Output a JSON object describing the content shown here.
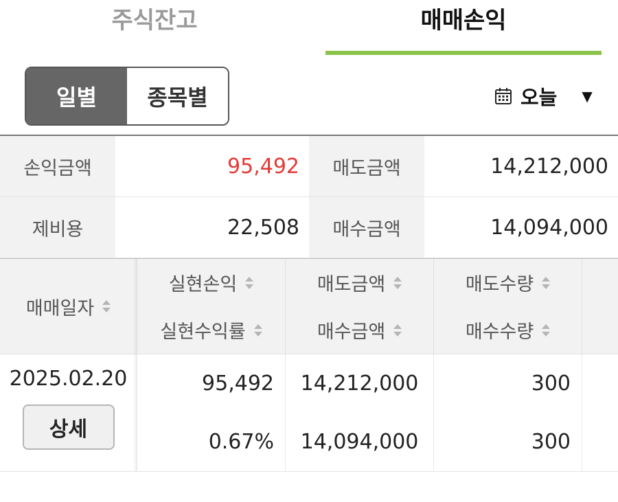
{
  "colors": {
    "accent": "#8bc34a",
    "red": "#e53935"
  },
  "tabs": [
    {
      "label": "주식잔고",
      "active": false
    },
    {
      "label": "매매손익",
      "active": true
    }
  ],
  "segment": {
    "daily": "일별",
    "by_stock": "종목별",
    "selected": "일별"
  },
  "date_selector": {
    "icon": "calendar-icon",
    "label": "오늘",
    "dropdown_icon": "caret-down-icon"
  },
  "summary": {
    "pnl_label": "손익금액",
    "pnl_value": "95,492",
    "sell_label": "매도금액",
    "sell_value": "14,212,000",
    "fee_label": "제비용",
    "fee_value": "22,508",
    "buy_label": "매수금액",
    "buy_value": "14,094,000"
  },
  "table": {
    "headers": {
      "trade_date": "매매일자",
      "realized_pnl": "실현손익",
      "realized_rate": "실현수익률",
      "sell_amount": "매도금액",
      "buy_amount": "매수금액",
      "sell_qty": "매도수량",
      "buy_qty": "매수수량"
    },
    "rows": [
      {
        "trade_date": "2025.02.20",
        "detail_label": "상세",
        "realized_pnl": "95,492",
        "realized_rate": "0.67%",
        "sell_amount": "14,212,000",
        "buy_amount": "14,094,000",
        "sell_qty": "300",
        "buy_qty": "300"
      }
    ]
  }
}
